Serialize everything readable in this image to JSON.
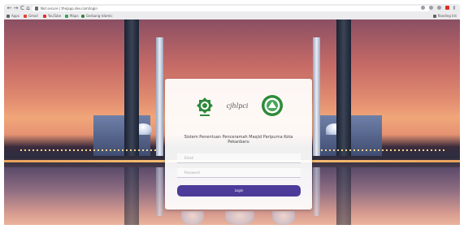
{
  "browser": {
    "back_glyph": "←",
    "forward_glyph": "→",
    "reload_glyph": "C",
    "home_glyph": "⌂",
    "url": "Not secure | thejapp.dev.com/login",
    "bookmarks": [
      {
        "label": "Apps",
        "icon": "apps-icon"
      },
      {
        "label": "Gmail",
        "icon": "gmail-icon"
      },
      {
        "label": "YouTube",
        "icon": "youtube-icon"
      },
      {
        "label": "Maps",
        "icon": "maps-icon"
      },
      {
        "label": "Gerbang Islamic",
        "icon": "gerbang-icon"
      }
    ],
    "reading_list": "Reading list"
  },
  "login": {
    "title": "Sistem Penentuan Penceramah Masjid Paripurna Kota Pekanbaru",
    "username_placeholder": "Email",
    "password_placeholder": "Password",
    "button_label": "Login",
    "middle_logo_text": "cjhlpci"
  },
  "colors": {
    "button": "#4d3b9a",
    "logo_green": "#2e8b3a"
  }
}
